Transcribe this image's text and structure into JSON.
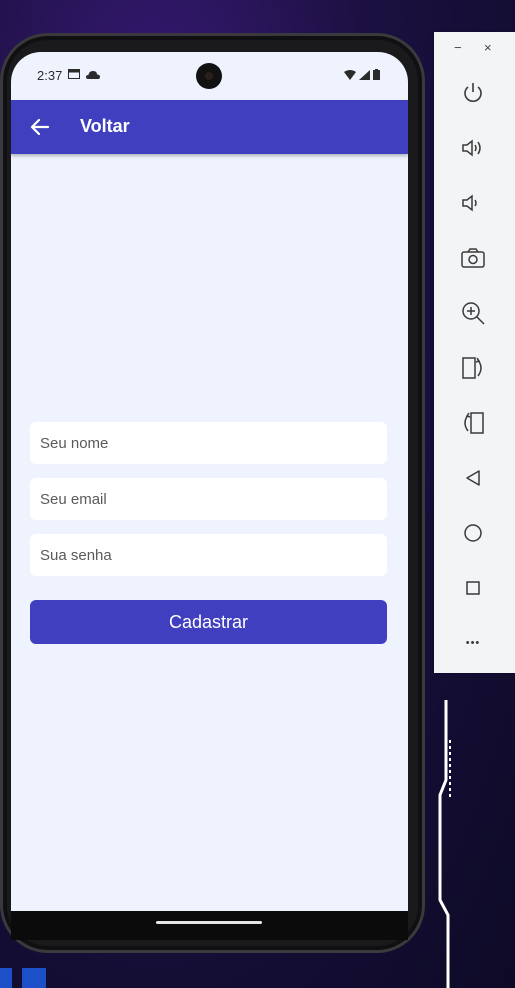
{
  "status_bar": {
    "time": "2:37"
  },
  "appbar": {
    "title": "Voltar"
  },
  "form": {
    "name_placeholder": "Seu nome",
    "email_placeholder": "Seu email",
    "password_placeholder": "Sua senha",
    "submit_label": "Cadastrar"
  },
  "emulator_panel": {
    "minimize": "−",
    "close": "×",
    "more": "•••",
    "buttons": [
      "power-icon",
      "volume-up-icon",
      "volume-down-icon",
      "camera-icon",
      "zoom-in-icon",
      "rotate-left-icon",
      "rotate-right-icon",
      "back-icon",
      "home-icon",
      "overview-icon",
      "more-icon"
    ]
  },
  "colors": {
    "accent": "#3f3fc0",
    "screen_bg": "#eef3fd"
  }
}
